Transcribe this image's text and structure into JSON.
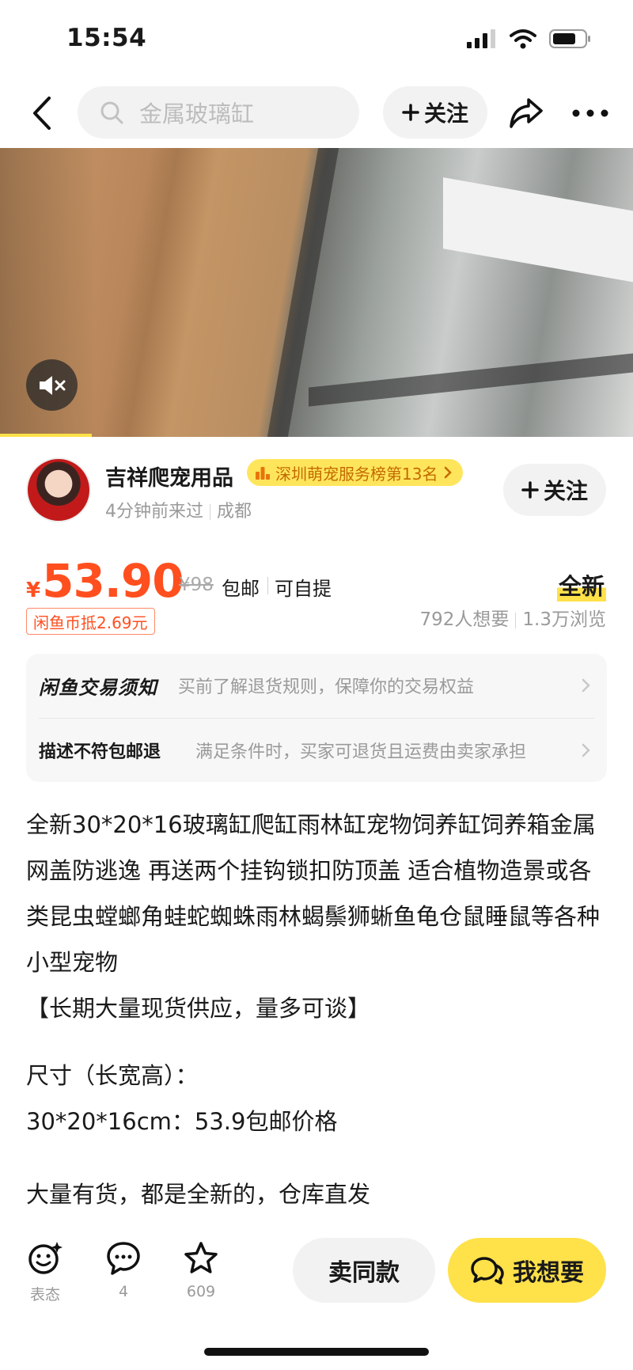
{
  "status_bar": {
    "time": "15:54"
  },
  "nav": {
    "search_placeholder": "金属玻璃缸",
    "follow_label": "关注"
  },
  "seller": {
    "name": "吉祥爬宠用品",
    "rank_badge": "深圳萌宠服务榜第13名",
    "last_seen": "4分钟前来过",
    "location": "成都",
    "follow_label": "关注"
  },
  "price": {
    "currency": "¥",
    "current": "53.90",
    "original": "¥98",
    "shipping": "包邮",
    "pickup": "可自提",
    "coin_discount": "闲鱼币抵2.69元",
    "condition": "全新",
    "wants": "792人想要",
    "views": "1.3万浏览"
  },
  "notices": [
    {
      "title": "闲鱼交易须知",
      "desc": "买前了解退货规则，保障你的交易权益"
    },
    {
      "title": "描述不符包邮退",
      "desc": "满足条件时，买家可退货且运费由卖家承担"
    }
  ],
  "description": {
    "paragraph": "全新30*20*16玻璃缸爬缸雨林缸宠物饲养缸饲养箱金属网盖防逃逸 再送两个挂钩锁扣防顶盖 适合植物造景或各类昆虫螳螂角蛙蛇蜘蛛雨林蝎鬃狮蜥鱼龟仓鼠睡鼠等各种小型宠物",
    "supply": "【长期大量现货供应，量多可谈】",
    "size_title": "尺寸（长宽高）：",
    "size_line": "30*20*16cm：53.9包邮价格",
    "stock": "大量有货，都是全新的，仓库直发"
  },
  "bottom_bar": {
    "react_label": "表态",
    "comments_count": "4",
    "favorites_count": "609",
    "sell_same_label": "卖同款",
    "want_label": "我想要"
  },
  "colors": {
    "accent": "#ffe14a",
    "price": "#ff4f1f"
  }
}
